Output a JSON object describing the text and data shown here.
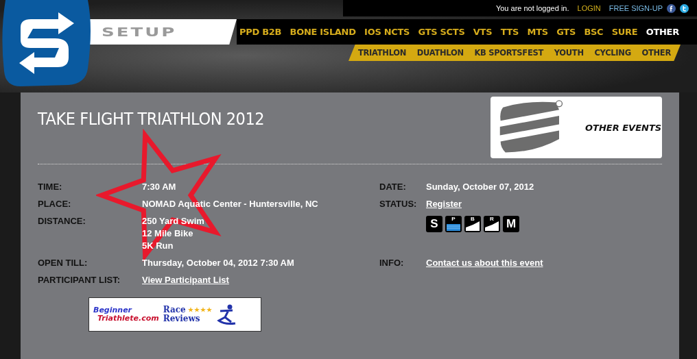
{
  "logo": {
    "wordmark": "SETUP"
  },
  "account": {
    "status": "You are not logged in.",
    "login": "LOGIN",
    "signup": "FREE SIGN-UP"
  },
  "main_nav": [
    {
      "label": "PPD B2B",
      "selected": false
    },
    {
      "label": "BONE ISLAND",
      "selected": false
    },
    {
      "label": "IOS NCTS",
      "selected": false
    },
    {
      "label": "GTS SCTS",
      "selected": false
    },
    {
      "label": "VTS",
      "selected": false
    },
    {
      "label": "TTS",
      "selected": false
    },
    {
      "label": "MTS",
      "selected": false
    },
    {
      "label": "GTS",
      "selected": false
    },
    {
      "label": "BSC",
      "selected": false
    },
    {
      "label": "SURE",
      "selected": false
    },
    {
      "label": "OTHER",
      "selected": true
    }
  ],
  "sub_nav": [
    {
      "label": "TRIATHLON",
      "selected": false
    },
    {
      "label": "DUATHLON",
      "selected": false
    },
    {
      "label": "KB SPORTSFEST",
      "selected": false
    },
    {
      "label": "YOUTH",
      "selected": false
    },
    {
      "label": "CYCLING",
      "selected": false
    },
    {
      "label": "OTHER",
      "selected": false
    }
  ],
  "event": {
    "title": "TAKE FLIGHT TRIATHLON 2012",
    "other_events": "OTHER EVENTS"
  },
  "details": [
    {
      "label": "TIME:",
      "kind": "text",
      "value": "7:30 AM"
    },
    {
      "label": "DATE:",
      "kind": "text",
      "value": "Sunday, October 07, 2012"
    },
    {
      "label": "PLACE:",
      "kind": "text",
      "value": "NOMAD Aquatic Center - Huntersville, NC"
    },
    {
      "label": "STATUS:",
      "kind": "link",
      "value": "Register"
    },
    {
      "label": "DISTANCE:",
      "kind": "lines",
      "lines": [
        "250 Yard Swim",
        "12 Mile Bike",
        "5K Run"
      ]
    },
    {
      "kind": "icons",
      "icons": [
        {
          "kind": "letter",
          "letter": "S"
        },
        {
          "kind": "swim",
          "letter": "P"
        },
        {
          "kind": "hill",
          "letter": "B"
        },
        {
          "kind": "hill",
          "letter": "R"
        },
        {
          "kind": "letter",
          "letter": "M"
        }
      ]
    },
    {
      "label": "OPEN TILL:",
      "kind": "text",
      "value": "Thursday, October 04, 2012  7:30 AM"
    },
    {
      "label": "INFO:",
      "kind": "link",
      "value": "Contact us about this event"
    },
    {
      "label": "PARTICIPANT LIST:",
      "kind": "link",
      "value": "View Participant List"
    }
  ],
  "banner": {
    "site_line1": "Beginner",
    "site_line2": "Triathlete.com",
    "race": "Race",
    "reviews": "Reviews",
    "stars": 4
  }
}
